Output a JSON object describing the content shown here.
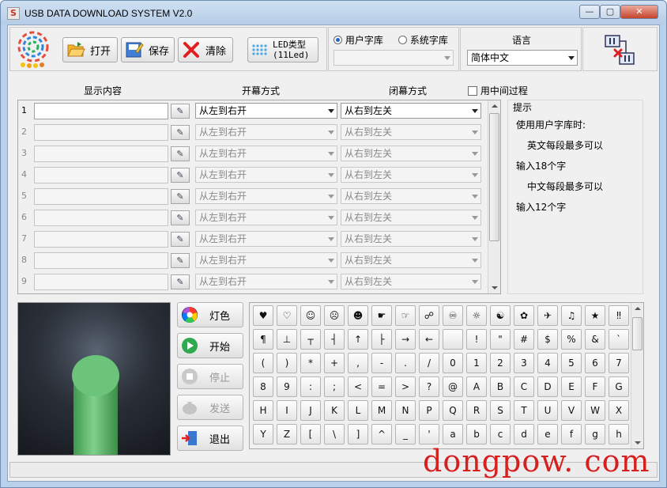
{
  "window": {
    "title": "USB DATA DOWNLOAD SYSTEM V2.0",
    "minimize": "—",
    "maximize": "▢",
    "close": "✕"
  },
  "toolbar": {
    "open_label": "打开",
    "save_label": "保存",
    "clear_label": "清除",
    "led_type_line1": "LED类型",
    "led_type_line2": "(11Led)"
  },
  "font_lib": {
    "user_label": "用户字库",
    "system_label": "系统字库",
    "user_selected": true,
    "select_value": ""
  },
  "language": {
    "label": "语言",
    "value": "简体中文"
  },
  "grid": {
    "col_content": "显示内容",
    "col_open": "开幕方式",
    "col_close": "闭幕方式",
    "use_intermediate": "用中间过程",
    "rows": [
      {
        "num": "1",
        "text": "",
        "open": "从左到右开",
        "close": "从右到左关",
        "enabled": true
      },
      {
        "num": "2",
        "text": "",
        "open": "从左到右开",
        "close": "从右到左关",
        "enabled": false
      },
      {
        "num": "3",
        "text": "",
        "open": "从左到右开",
        "close": "从右到左关",
        "enabled": false
      },
      {
        "num": "4",
        "text": "",
        "open": "从左到右开",
        "close": "从右到左关",
        "enabled": false
      },
      {
        "num": "5",
        "text": "",
        "open": "从左到右开",
        "close": "从右到左关",
        "enabled": false
      },
      {
        "num": "6",
        "text": "",
        "open": "从左到右开",
        "close": "从右到左关",
        "enabled": false
      },
      {
        "num": "7",
        "text": "",
        "open": "从左到右开",
        "close": "从右到左关",
        "enabled": false
      },
      {
        "num": "8",
        "text": "",
        "open": "从左到右开",
        "close": "从右到左关",
        "enabled": false
      },
      {
        "num": "9",
        "text": "",
        "open": "从左到右开",
        "close": "从右到左关",
        "enabled": false
      }
    ]
  },
  "tips": {
    "title": "提示",
    "lines": [
      "使用用户字库时:",
      "英文每段最多可以",
      "输入18个字",
      "中文每段最多可以",
      "输入12个字"
    ]
  },
  "controls": {
    "light_color": "灯色",
    "start": "开始",
    "stop": "停止",
    "send": "发送",
    "exit": "退出"
  },
  "keyboard": {
    "rows": [
      [
        "♥",
        "♡",
        "☺",
        "☹",
        "☻",
        "☛",
        "☞",
        "☍",
        "♾",
        "☼",
        "☯",
        "✿",
        "✈",
        "♫",
        "★",
        "‼"
      ],
      [
        "¶",
        "⊥",
        "┬",
        "┤",
        "↑",
        "├",
        "→",
        "←",
        " ",
        "!",
        "\"",
        "#",
        "$",
        "%",
        "&",
        "`"
      ],
      [
        "(",
        ")",
        "*",
        "+",
        ",",
        "-",
        ".",
        "/",
        "0",
        "1",
        "2",
        "3",
        "4",
        "5",
        "6",
        "7"
      ],
      [
        "8",
        "9",
        ":",
        ";",
        "<",
        "=",
        ">",
        "?",
        "@",
        "A",
        "B",
        "C",
        "D",
        "E",
        "F",
        "G"
      ],
      [
        "H",
        "I",
        "J",
        "K",
        "L",
        "M",
        "N",
        "P",
        "Q",
        "R",
        "S",
        "T",
        "U",
        "V",
        "W",
        "X"
      ],
      [
        "Y",
        "Z",
        "[",
        "\\",
        "]",
        "^",
        "_",
        "'",
        "a",
        "b",
        "c",
        "d",
        "e",
        "f",
        "g",
        "h"
      ]
    ]
  },
  "watermark": "dongpow. com"
}
